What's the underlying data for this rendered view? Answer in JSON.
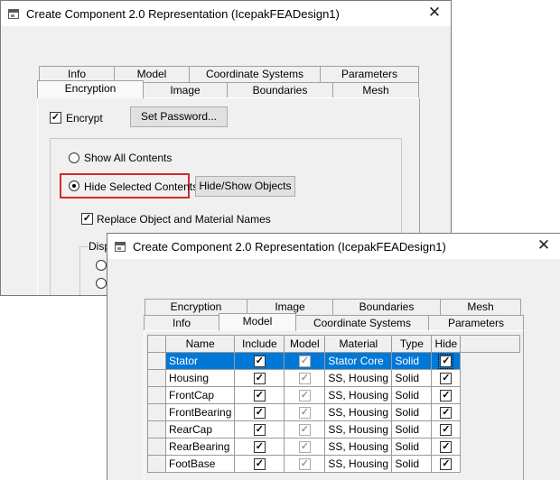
{
  "back_window": {
    "title": "Create Component 2.0 Representation (IcepakFEADesign1)",
    "tabs_row1": [
      "Info",
      "Model",
      "Coordinate Systems",
      "Parameters"
    ],
    "tabs_row2": [
      "Encryption",
      "Image",
      "Boundaries",
      "Mesh"
    ],
    "active_tab": "Encryption",
    "encrypt_label": "Encrypt",
    "encrypt_checked": true,
    "set_password_label": "Set Password...",
    "show_all_label": "Show All Contents",
    "hide_selected_label": "Hide Selected Contents",
    "hide_show_objects_label": "Hide/Show Objects",
    "replace_names_label": "Replace Object and Material Names",
    "replace_names_checked": true,
    "display_group_label": "Displ"
  },
  "front_window": {
    "title": "Create Component 2.0 Representation (IcepakFEADesign1)",
    "tabs_row1": [
      "Encryption",
      "Image",
      "Boundaries",
      "Mesh"
    ],
    "tabs_row2": [
      "Info",
      "Model",
      "Coordinate Systems",
      "Parameters"
    ],
    "active_tab": "Model",
    "table": {
      "columns": [
        "Name",
        "Include",
        "Model",
        "Material",
        "Type",
        "Hide"
      ],
      "rows": [
        {
          "name": "Stator",
          "material": "Stator Core",
          "type": "Solid",
          "selected": true
        },
        {
          "name": "Housing",
          "material": "SS, Housing",
          "type": "Solid",
          "selected": false
        },
        {
          "name": "FrontCap",
          "material": "SS, Housing",
          "type": "Solid",
          "selected": false
        },
        {
          "name": "FrontBearing",
          "material": "SS, Housing",
          "type": "Solid",
          "selected": false
        },
        {
          "name": "RearCap",
          "material": "SS, Housing",
          "type": "Solid",
          "selected": false
        },
        {
          "name": "RearBearing",
          "material": "SS, Housing",
          "type": "Solid",
          "selected": false
        },
        {
          "name": "FootBase",
          "material": "SS, Housing",
          "type": "Solid",
          "selected": false
        }
      ]
    }
  },
  "colors": {
    "selection": "#0078d7",
    "highlight_box": "#d42a2a",
    "window_bg": "#f0f0f0"
  }
}
